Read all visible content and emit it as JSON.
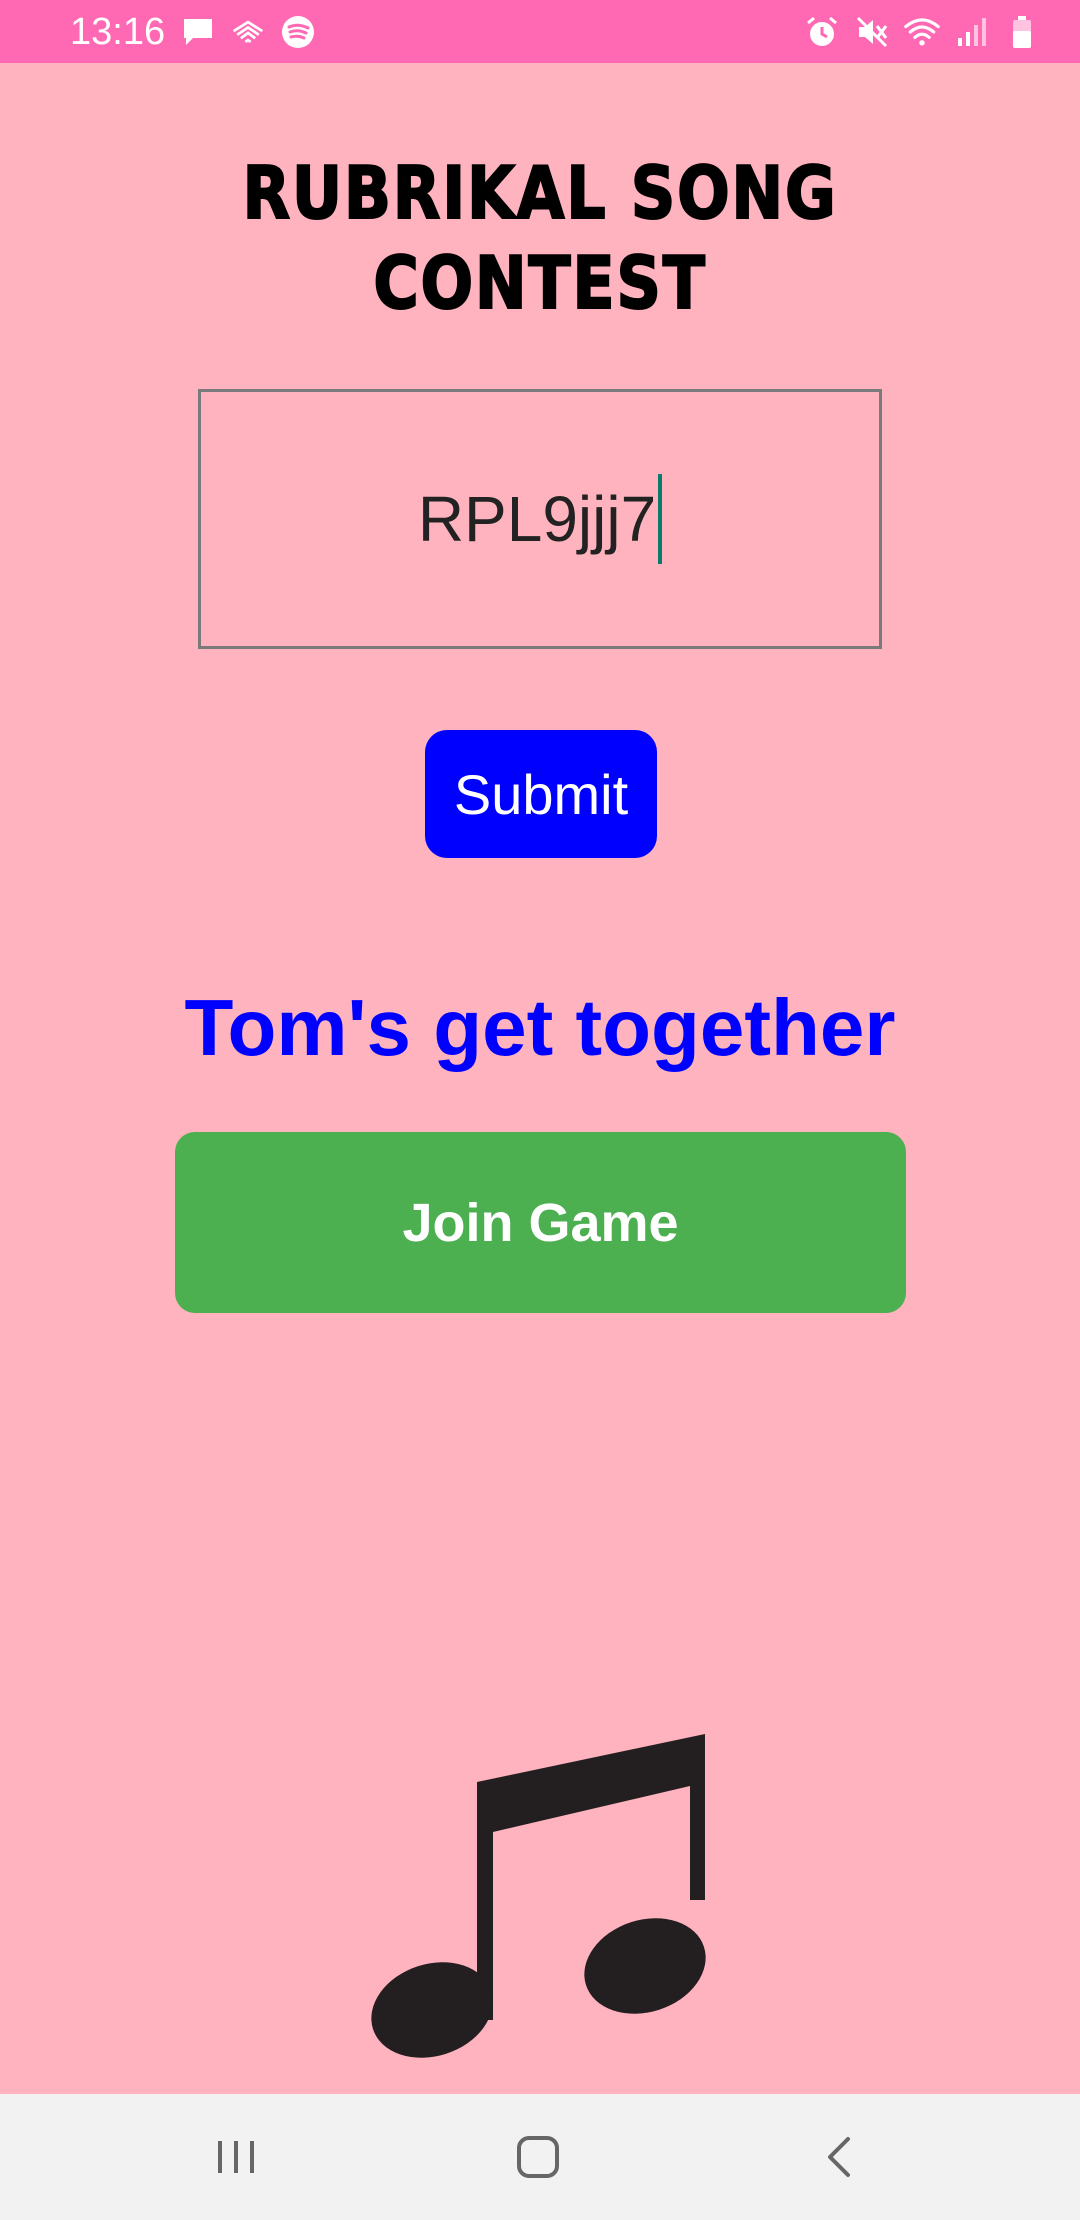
{
  "status_bar": {
    "time": "13:16",
    "left_icons": [
      "message-icon",
      "cast-icon",
      "spotify-icon"
    ],
    "right_icons": [
      "alarm-icon",
      "mute-icon",
      "wifi-icon",
      "signal-icon",
      "battery-icon"
    ]
  },
  "app": {
    "title": "RUBRIKAL SONG CONTEST"
  },
  "code_field": {
    "value": "RPL9jjj7"
  },
  "submit_button": {
    "label": "Submit"
  },
  "game": {
    "name": "Tom's get together",
    "join_label": "Join Game"
  },
  "colors": {
    "background": "#ffb3bf",
    "status_bar": "#ff69b4",
    "submit": "#0000ff",
    "game_name": "#0000ff",
    "join": "#4caf50"
  },
  "nav_bar": {
    "items": [
      "recent-apps-icon",
      "home-icon",
      "back-icon"
    ]
  }
}
